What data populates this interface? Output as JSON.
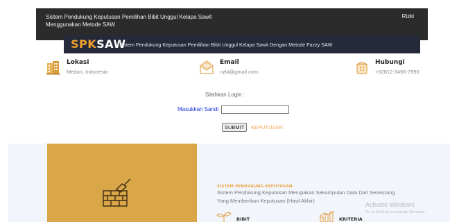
{
  "header": {
    "title": "Sistem Pendukung Keputusan Pemilihan Bibit Unggul Kelapa Sawit Menggunakan Metode SAW",
    "user": "Rizki"
  },
  "brand": {
    "part1": "SPK",
    "part2": "SAW",
    "subtitle": "Sistem Pendukung Keputusan Pemilihan Bibit Unggul Kelapa Sawit Dengan Metode Fuzzy SAW"
  },
  "contact": {
    "location": {
      "label": "Lokasi",
      "value": "Medan, Indonesia",
      "icon": "building-icon"
    },
    "email": {
      "label": "Email",
      "value": "rizki@gmail.com",
      "icon": "envelope-icon"
    },
    "phone": {
      "label": "Hubungi",
      "value": "+62812-3456-7890",
      "icon": "phone-icon"
    }
  },
  "login": {
    "title": "Silahkan Login :",
    "password_label": "Masukkan Sandi",
    "password_value": "",
    "submit_label": "SUBMIT",
    "decision_link": "KEPUTUSAN"
  },
  "about": {
    "icon": "brick-wall-trowel-icon",
    "section_title": "SISTEM PENDUKUNG KEPUTUSAN",
    "description": "Sistem Pendukung Keputusan Merupakan Sekumpulan Data Dari Seseorang Yang Memberikan Keputusan (Hasil Akhir)",
    "features": [
      {
        "label": "BIBIT",
        "icon": "seedling-icon"
      },
      {
        "label": "KRITERIA",
        "icon": "chart-icon"
      }
    ]
  },
  "watermark": {
    "line1": "Activate Windows",
    "line2": "Go to Settings to activate Windows."
  },
  "colors": {
    "topbar": "#2b2b2b",
    "brandbar": "#252a3a",
    "accent": "#f0a02c",
    "gold_panel": "#d9a648",
    "link_blue": "#1a33e0"
  }
}
